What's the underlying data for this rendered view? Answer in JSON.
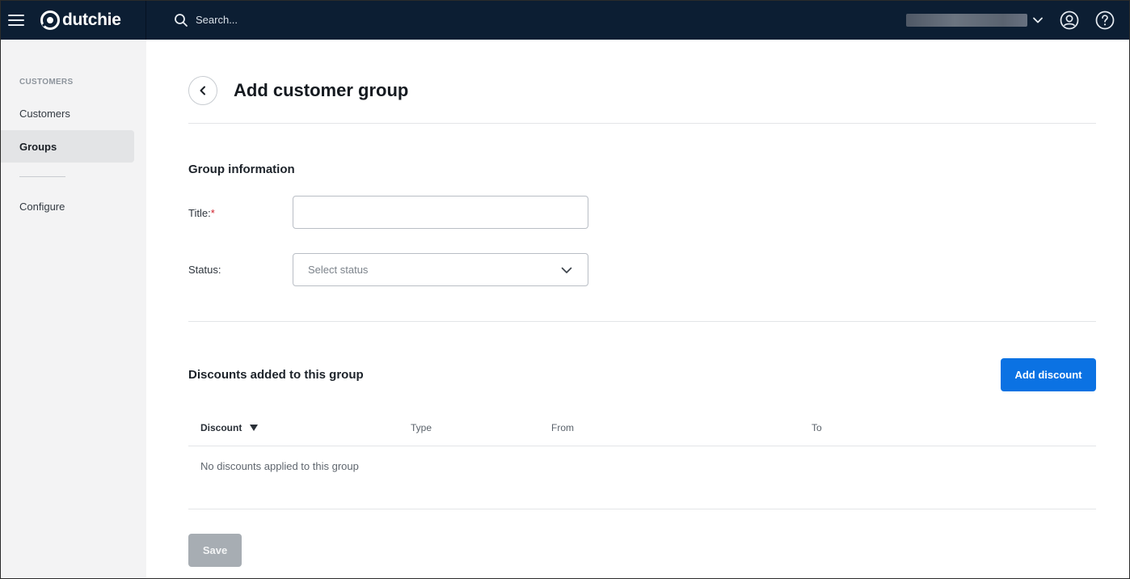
{
  "header": {
    "brand": "dutchie",
    "search_placeholder": "Search...",
    "icons": [
      "menu-icon",
      "dutchie-logo-icon",
      "search-icon",
      "chevron-down-icon",
      "user-circle-icon",
      "help-circle-icon"
    ]
  },
  "sidebar": {
    "heading": "CUSTOMERS",
    "items": [
      {
        "label": "Customers",
        "active": false
      },
      {
        "label": "Groups",
        "active": true
      },
      {
        "label": "Configure",
        "active": false
      }
    ]
  },
  "page": {
    "title": "Add customer group"
  },
  "group_info": {
    "section_title": "Group information",
    "title_label": "Title:",
    "title_required_mark": "*",
    "title_value": "",
    "status_label": "Status:",
    "status_placeholder": "Select status"
  },
  "discounts": {
    "section_title": "Discounts added to this group",
    "add_button": "Add discount",
    "columns": [
      "Discount",
      "Type",
      "From",
      "To"
    ],
    "sorted_column": "Discount",
    "empty_message": "No discounts applied to this group"
  },
  "actions": {
    "save_label": "Save"
  },
  "colors": {
    "topbar": "#0c1e33",
    "sidebar": "#f3f3f4",
    "primary": "#0b72e3",
    "disabled": "#a7adb3",
    "required": "#d0202c"
  }
}
